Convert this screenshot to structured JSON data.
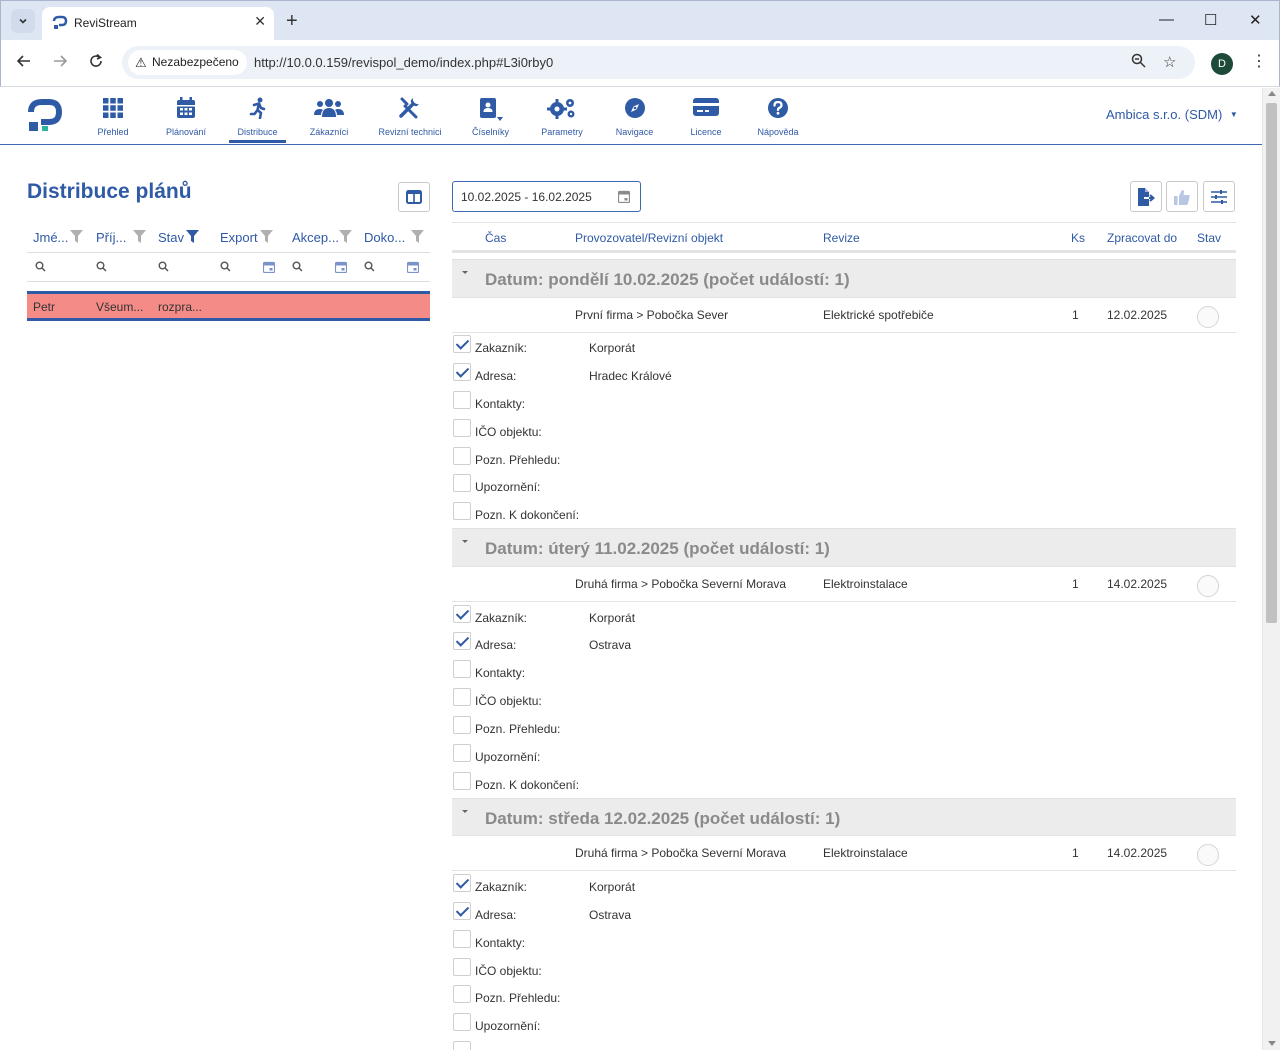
{
  "browser": {
    "tab_title": "ReviStream",
    "security_label": "Nezabezpečeno",
    "url": "http://10.0.0.159/revispol_demo/index.php#L3i0rby0",
    "profile_initial": "D"
  },
  "nav": {
    "items": [
      {
        "label": "Přehled",
        "icon": "grid-icon"
      },
      {
        "label": "Plánování",
        "icon": "calendar-icon"
      },
      {
        "label": "Distribuce",
        "icon": "running-person-icon"
      },
      {
        "label": "Zákazníci",
        "icon": "users-icon"
      },
      {
        "label": "Revizní technici",
        "icon": "tools-icon"
      },
      {
        "label": "Číselníky",
        "icon": "address-book-icon"
      },
      {
        "label": "Parametry",
        "icon": "gears-icon"
      },
      {
        "label": "Navigace",
        "icon": "compass-icon"
      },
      {
        "label": "Licence",
        "icon": "credit-card-icon"
      },
      {
        "label": "Nápověda",
        "icon": "help-icon"
      }
    ],
    "active_index": 2,
    "company": "Ambica s.r.o. (SDM)"
  },
  "left": {
    "title": "Distribuce plánů",
    "columns": [
      "Jmé...",
      "Příj...",
      "Stav",
      "Export",
      "Akcep...",
      "Doko..."
    ],
    "rows": [
      {
        "jmeno": "Petr",
        "prijmeni": "Všeum...",
        "stav": "rozpra..."
      }
    ]
  },
  "right": {
    "date_range": "10.02.2025 - 16.02.2025",
    "columns": {
      "cas": "Čas",
      "provozovatel": "Provozovatel/Revizní objekt",
      "revize": "Revize",
      "ks": "Ks",
      "zpracovat": "Zpracovat do",
      "stav": "Stav"
    },
    "detail_labels": [
      "Zakazník:",
      "Adresa:",
      "Kontakty:",
      "IČO objektu:",
      "Pozn. Přehledu:",
      "Upozornění:",
      "Pozn. K dokončení:"
    ],
    "groups": [
      {
        "title": "Datum: pondělí 10.02.2025 (počet událostí: 1)",
        "event": {
          "objekt": "První firma > Pobočka Sever",
          "revize": "Elektrické spotřebiče",
          "ks": "1",
          "zpracovat": "12.02.2025"
        },
        "zakaznik": "Korporát",
        "adresa": "Hradec Králové"
      },
      {
        "title": "Datum: úterý 11.02.2025 (počet událostí: 1)",
        "event": {
          "objekt": "Druhá firma > Pobočka Severní Morava",
          "revize": "Elektroinstalace",
          "ks": "1",
          "zpracovat": "14.02.2025"
        },
        "zakaznik": "Korporát",
        "adresa": "Ostrava"
      },
      {
        "title": "Datum: středa 12.02.2025 (počet událostí: 1)",
        "event": {
          "objekt": "Druhá firma > Pobočka Severní Morava",
          "revize": "Elektroinstalace",
          "ks": "1",
          "zpracovat": "14.02.2025"
        },
        "zakaznik": "Korporát",
        "adresa": "Ostrava"
      }
    ]
  },
  "colors": {
    "primary": "#2f5aa5",
    "row_highlight": "#f48b86",
    "group_bg": "#ececec"
  }
}
